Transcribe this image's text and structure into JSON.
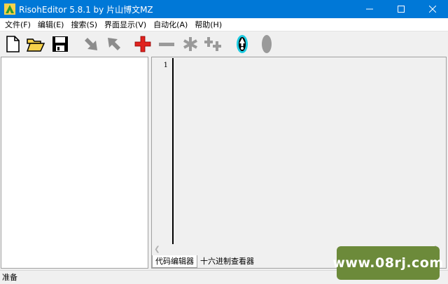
{
  "window": {
    "title": "RisohEditor 5.8.1 by 片山博文MZ"
  },
  "menu": {
    "items": [
      {
        "label": "文件(F)"
      },
      {
        "label": "编辑(E)"
      },
      {
        "label": "搜索(S)"
      },
      {
        "label": "界面显示(V)"
      },
      {
        "label": "自动化(A)"
      },
      {
        "label": "帮助(H)"
      }
    ]
  },
  "toolbar": {
    "icons": [
      "new-file-icon",
      "open-folder-icon",
      "save-icon",
      "move-down-icon",
      "move-up-icon",
      "add-icon",
      "remove-icon",
      "asterisk-icon",
      "add-plus-icon",
      "compile-icon",
      "ellipse-icon"
    ],
    "colors": {
      "add": "#e0231e",
      "disabled": "#8c8c8c",
      "compile": "#1ecbe1",
      "folder": "#f7d24b"
    }
  },
  "editor": {
    "line_numbers": [
      "1"
    ]
  },
  "tabs": [
    {
      "label": "代码编辑器",
      "active": true
    },
    {
      "label": "十六进制查看器",
      "active": false
    }
  ],
  "status": {
    "text": "准备"
  },
  "watermark": {
    "text": "www.08rj.com"
  }
}
